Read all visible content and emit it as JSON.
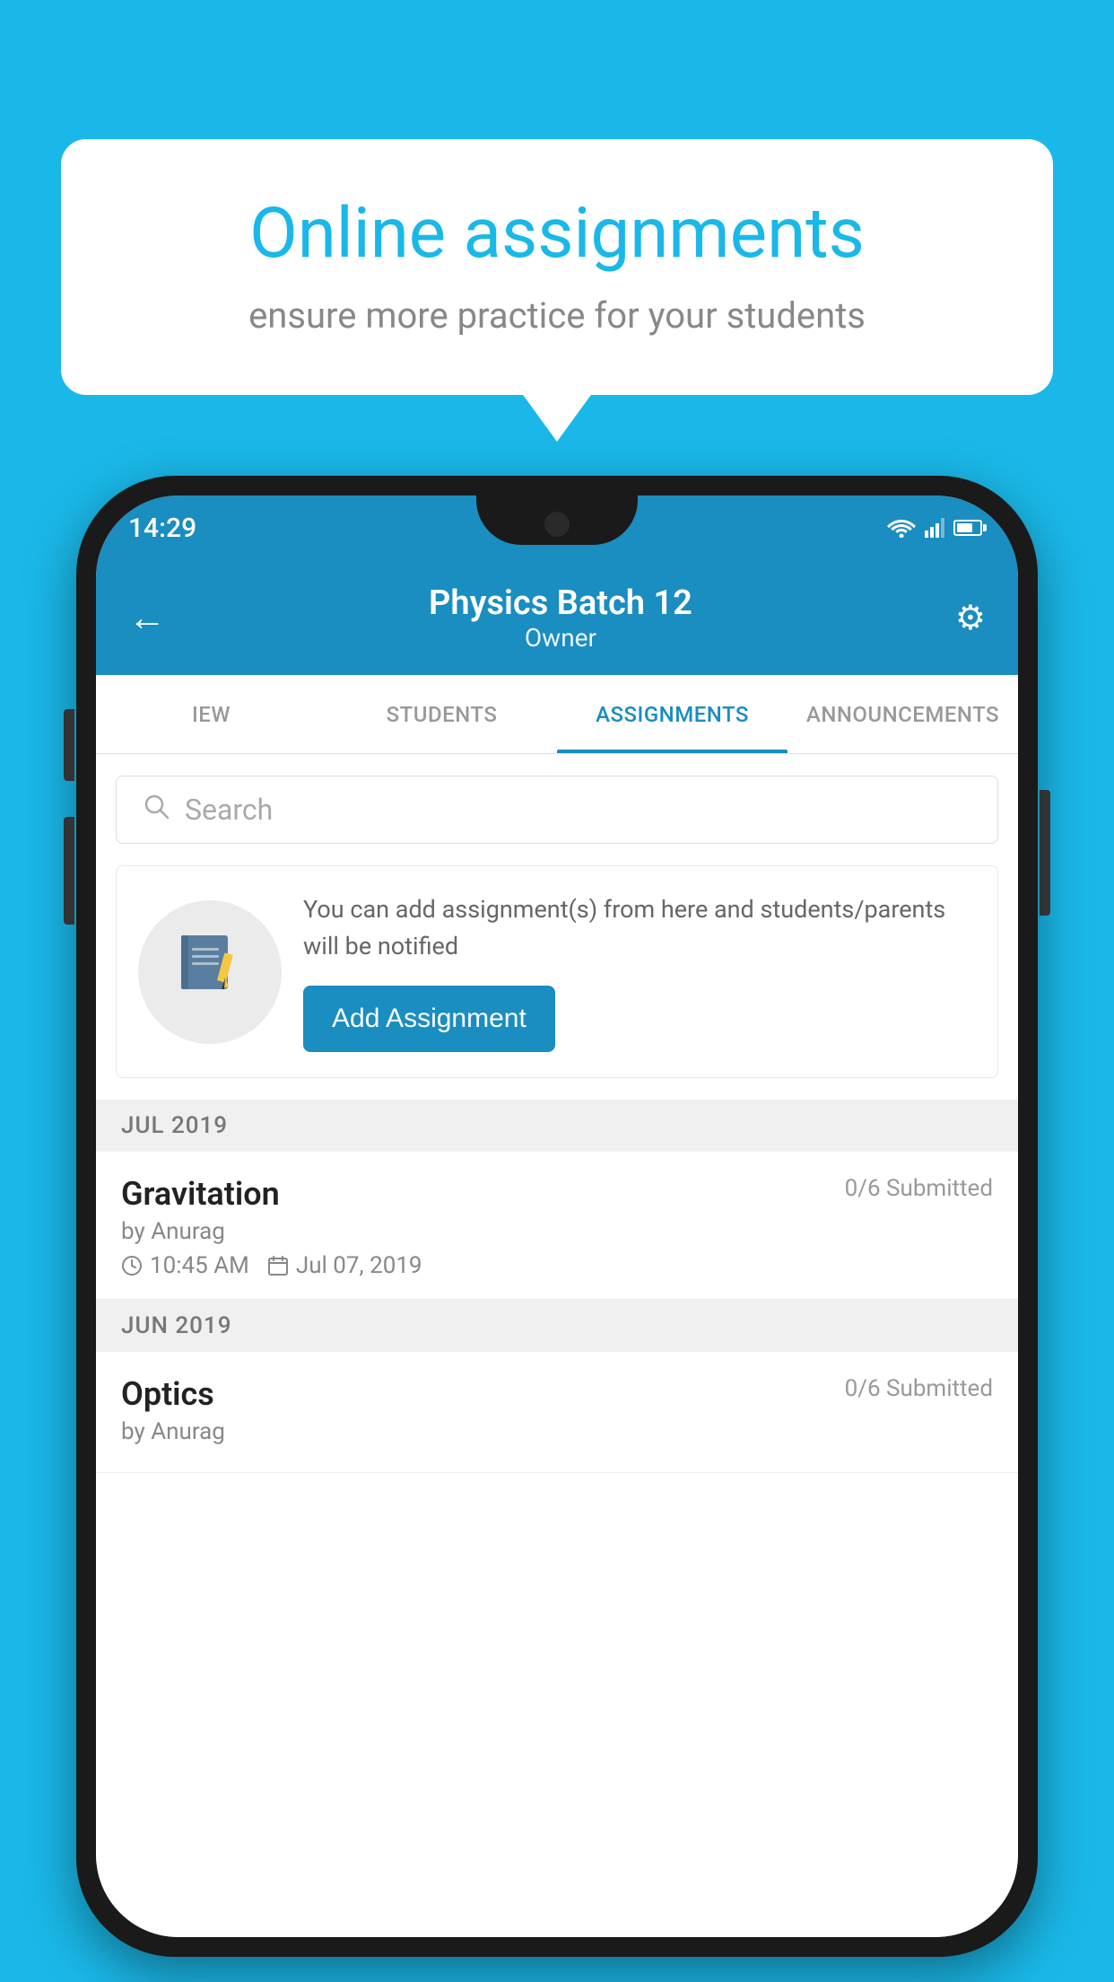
{
  "background_color": "#1ab8e8",
  "speech_bubble": {
    "title": "Online assignments",
    "subtitle": "ensure more practice for your students"
  },
  "status_bar": {
    "time": "14:29"
  },
  "app_header": {
    "title": "Physics Batch 12",
    "subtitle": "Owner",
    "back_label": "←",
    "settings_label": "⚙"
  },
  "tabs": [
    {
      "label": "IEW",
      "active": false
    },
    {
      "label": "STUDENTS",
      "active": false
    },
    {
      "label": "ASSIGNMENTS",
      "active": true
    },
    {
      "label": "ANNOUNCEMENTS",
      "active": false
    }
  ],
  "search": {
    "placeholder": "Search"
  },
  "promo": {
    "text": "You can add assignment(s) from here and students/parents will be notified",
    "button_label": "Add Assignment"
  },
  "sections": [
    {
      "label": "JUL 2019",
      "assignments": [
        {
          "name": "Gravitation",
          "status": "0/6 Submitted",
          "by": "by Anurag",
          "time": "10:45 AM",
          "date": "Jul 07, 2019"
        }
      ]
    },
    {
      "label": "JUN 2019",
      "assignments": [
        {
          "name": "Optics",
          "status": "0/6 Submitted",
          "by": "by Anurag",
          "time": "",
          "date": ""
        }
      ]
    }
  ]
}
